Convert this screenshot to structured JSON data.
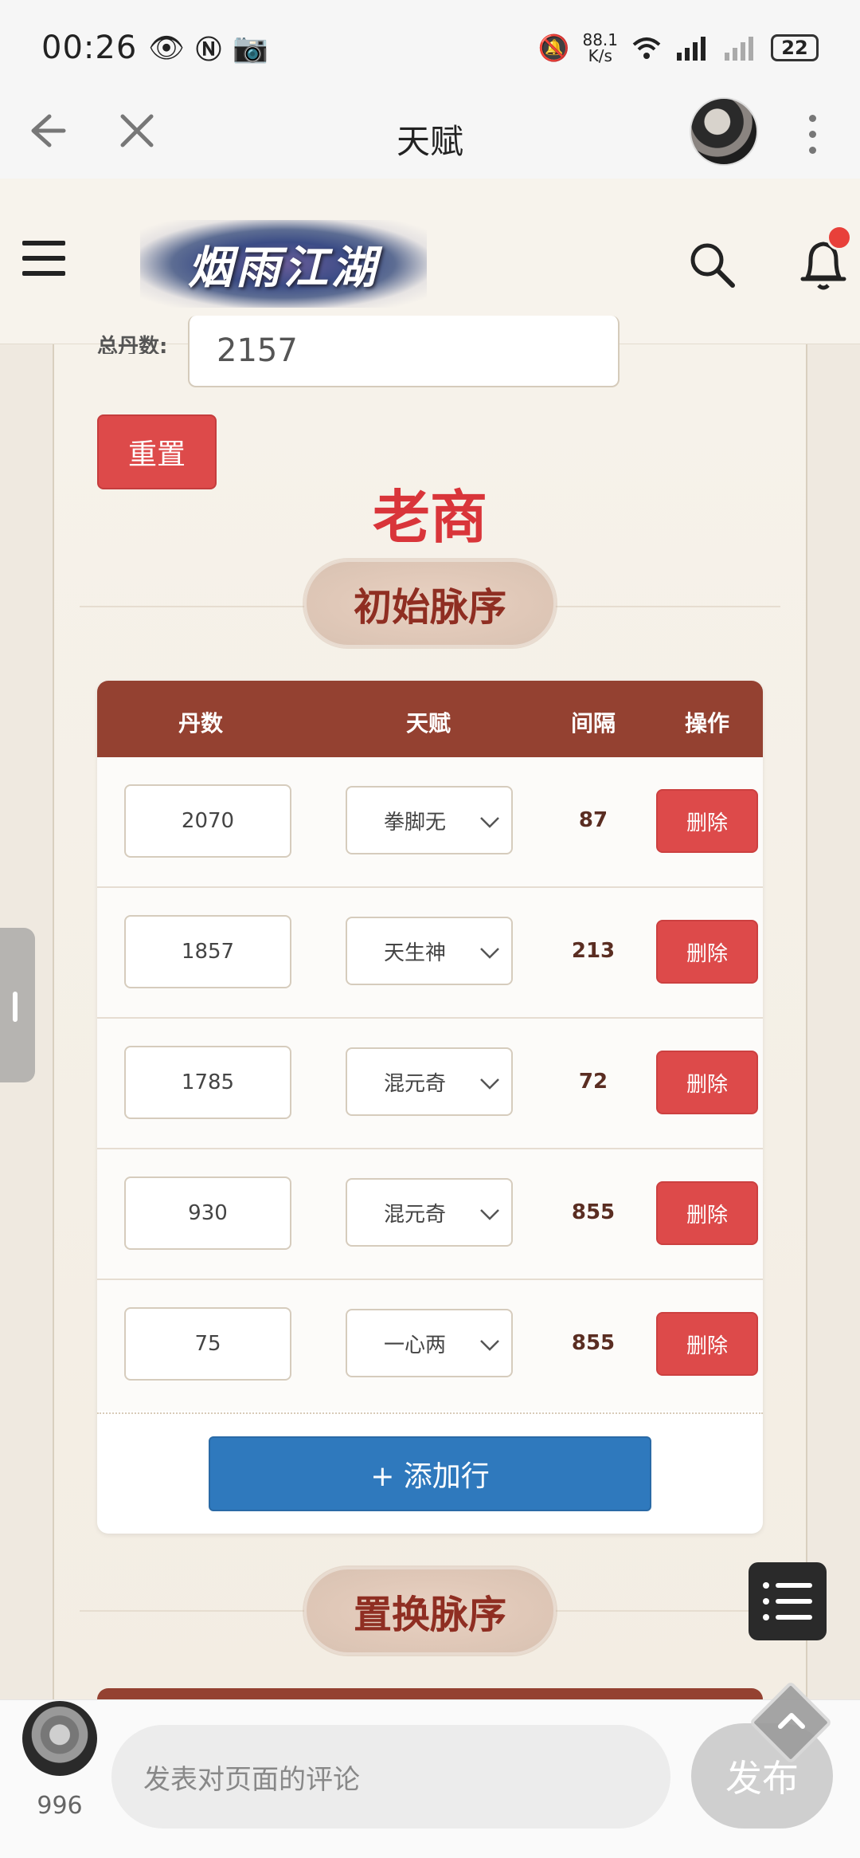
{
  "status_bar": {
    "time": "00:26",
    "net_speed_value": "88.1",
    "net_speed_unit": "K/s",
    "battery": "22"
  },
  "browser": {
    "title": "天赋"
  },
  "site": {
    "logo_text": "烟雨江湖"
  },
  "form": {
    "total_label": "总丹数:",
    "total_value": "2157",
    "reset_label": "重置",
    "character_name": "老商"
  },
  "section1": {
    "title": "初始脉序",
    "columns": [
      "丹数",
      "天赋",
      "间隔",
      "操作"
    ],
    "rows": [
      {
        "dan": "2070",
        "talent": "拳脚无",
        "gap": "87",
        "action": "删除"
      },
      {
        "dan": "1857",
        "talent": "天生神",
        "gap": "213",
        "action": "删除"
      },
      {
        "dan": "1785",
        "talent": "混元奇",
        "gap": "72",
        "action": "删除"
      },
      {
        "dan": "930",
        "talent": "混元奇",
        "gap": "855",
        "action": "删除"
      },
      {
        "dan": "75",
        "talent": "一心两",
        "gap": "855",
        "action": "删除"
      }
    ],
    "add_row_label": "+ 添加行"
  },
  "section2": {
    "title": "置换脉序"
  },
  "comment_bar": {
    "count": "996",
    "placeholder": "发表对页面的评论",
    "publish_label": "发布"
  },
  "colors": {
    "accent_red": "#dd4a4a",
    "header_brown": "#944131",
    "add_blue": "#2f79bd",
    "title_red": "#d9353a"
  }
}
